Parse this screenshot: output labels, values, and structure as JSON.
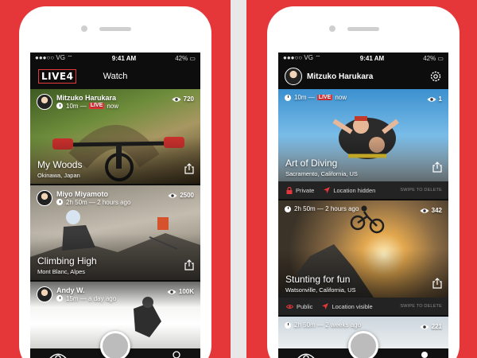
{
  "status": {
    "carrier": "VG",
    "time": "9:41 AM",
    "battery": "42%"
  },
  "phone1": {
    "logo": "LIVE4",
    "title": "Watch",
    "feed": [
      {
        "user": "Mitzuko Harukara",
        "elapsed": "10m",
        "sep": "—",
        "live": "LIVE",
        "when": "now",
        "views": "720",
        "title": "My Woods",
        "location": "Okinawa, Japan"
      },
      {
        "user": "Miyo Miyamoto",
        "elapsed": "2h 50m",
        "sep": "—",
        "when": "2 hours ago",
        "views": "2500",
        "title": "Climbing High",
        "location": "Mont Blanc, Alpes"
      },
      {
        "user": "Andy W.",
        "elapsed": "15m",
        "sep": "—",
        "when": "a day ago",
        "views": "100K"
      }
    ]
  },
  "phone2": {
    "user": "Mitzuko Harukara",
    "feed": [
      {
        "elapsed": "10m",
        "sep": "—",
        "live": "LIVE",
        "when": "now",
        "views": "1",
        "title": "Art of Diving",
        "location": "Sacramento, California, US",
        "privacy": "Private",
        "locstatus": "Location hidden",
        "swipe": "SWIPE TO DELETE"
      },
      {
        "elapsed": "2h 50m",
        "sep": "—",
        "when": "2 hours ago",
        "views": "342",
        "title": "Stunting for fun",
        "location": "Watsonville, California, US",
        "privacy": "Public",
        "locstatus": "Location visible",
        "swipe": "SWIPE TO DELETE"
      },
      {
        "elapsed": "2h 50m",
        "sep": "—",
        "when": "2 weeks ago",
        "views": "221"
      }
    ]
  },
  "icons": [
    "eye-icon",
    "clock-icon",
    "share-icon",
    "lock-icon",
    "location-arrow-icon",
    "gear-icon",
    "user-icon",
    "record-button"
  ],
  "colors": {
    "accent": "#e5373a",
    "bar": "#111111",
    "screen": "#0d0d0d"
  }
}
